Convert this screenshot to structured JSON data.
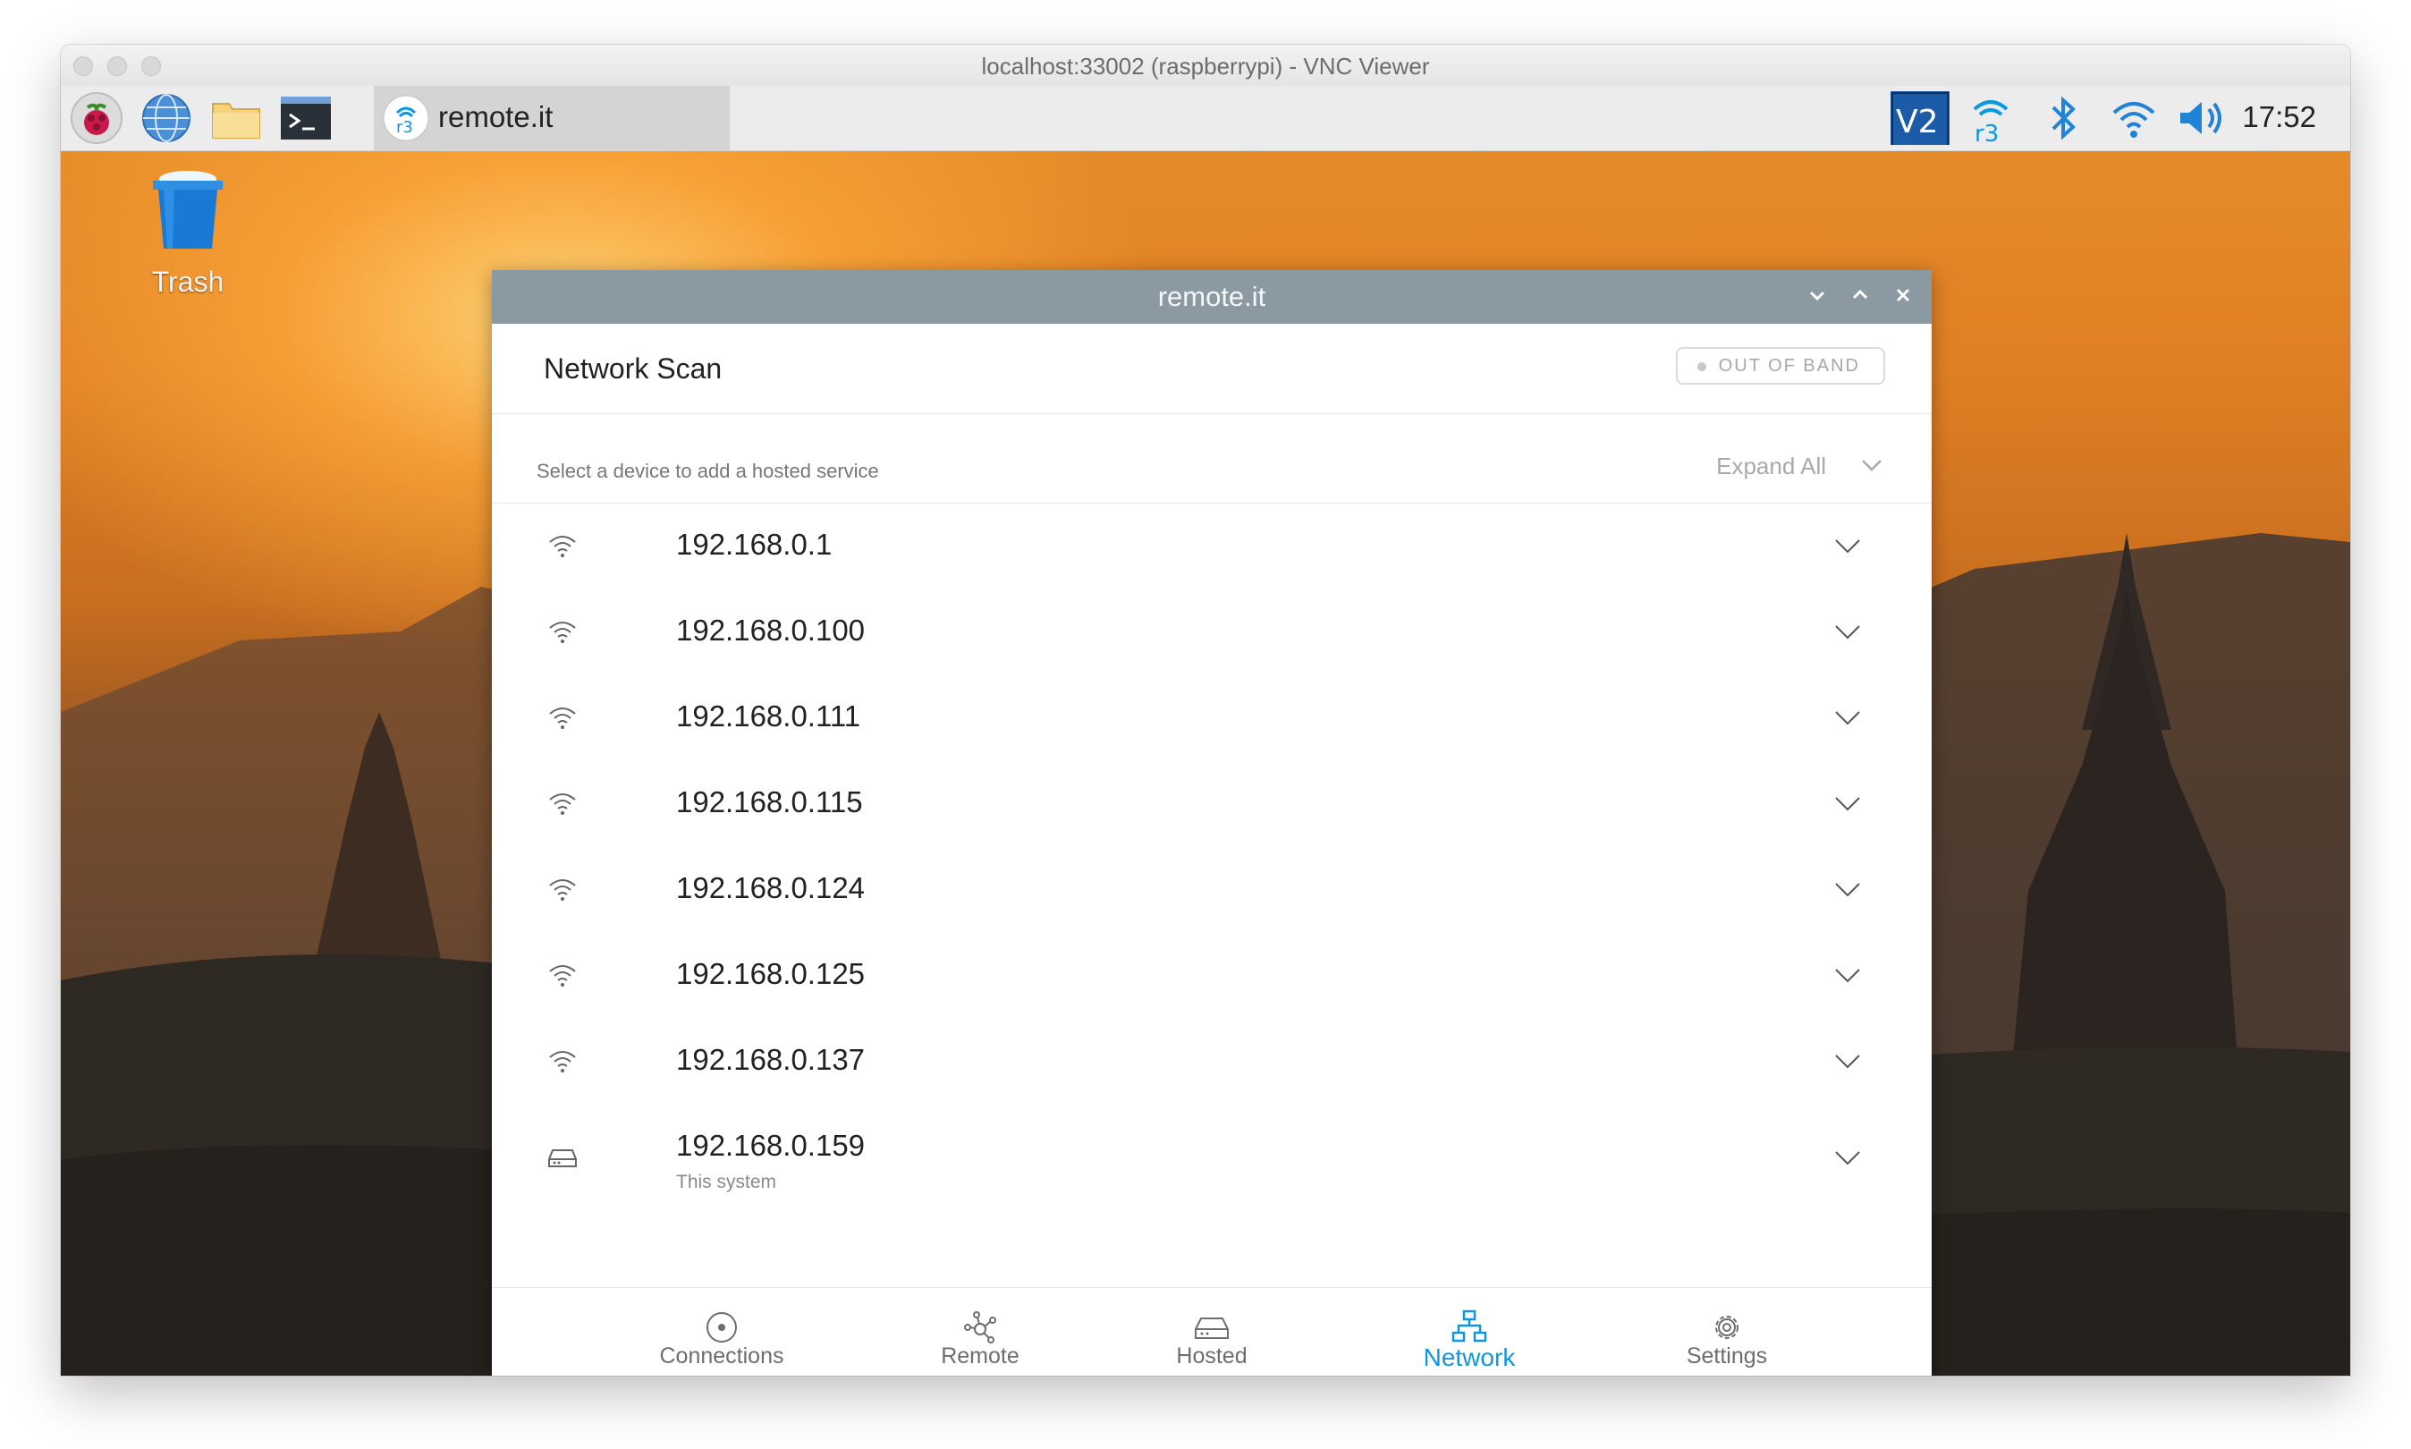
{
  "vnc": {
    "title": "localhost:33002 (raspberrypi) - VNC Viewer"
  },
  "taskbar": {
    "icons": [
      "raspberry-menu-icon",
      "web-browser-icon",
      "file-manager-icon",
      "terminal-icon"
    ],
    "active_app_label": "remote.it",
    "tray": [
      "vnc-server-icon",
      "remoteit-tray-icon",
      "bluetooth-icon",
      "wifi-icon",
      "volume-icon"
    ],
    "clock": "17:52"
  },
  "desktop": {
    "trash_label": "Trash"
  },
  "app": {
    "title": "remote.it",
    "page_title": "Network Scan",
    "badge": "OUT OF BAND",
    "hint": "Select a device to add a hosted service",
    "expand_all": "Expand All",
    "devices": [
      {
        "ip": "192.168.0.1",
        "icon": "wifi-icon"
      },
      {
        "ip": "192.168.0.100",
        "icon": "wifi-icon"
      },
      {
        "ip": "192.168.0.111",
        "icon": "wifi-icon"
      },
      {
        "ip": "192.168.0.115",
        "icon": "wifi-icon"
      },
      {
        "ip": "192.168.0.124",
        "icon": "wifi-icon"
      },
      {
        "ip": "192.168.0.125",
        "icon": "wifi-icon"
      },
      {
        "ip": "192.168.0.137",
        "icon": "wifi-icon"
      },
      {
        "ip": "192.168.0.159",
        "icon": "hard-drive-icon",
        "subtitle": "This system"
      }
    ],
    "nav": [
      {
        "label": "Connections",
        "icon": "connections-icon"
      },
      {
        "label": "Remote",
        "icon": "remote-icon"
      },
      {
        "label": "Hosted",
        "icon": "hosted-icon"
      },
      {
        "label": "Network",
        "icon": "network-icon",
        "active": true
      },
      {
        "label": "Settings",
        "icon": "settings-icon"
      }
    ],
    "accent_color": "#0d97e0"
  }
}
